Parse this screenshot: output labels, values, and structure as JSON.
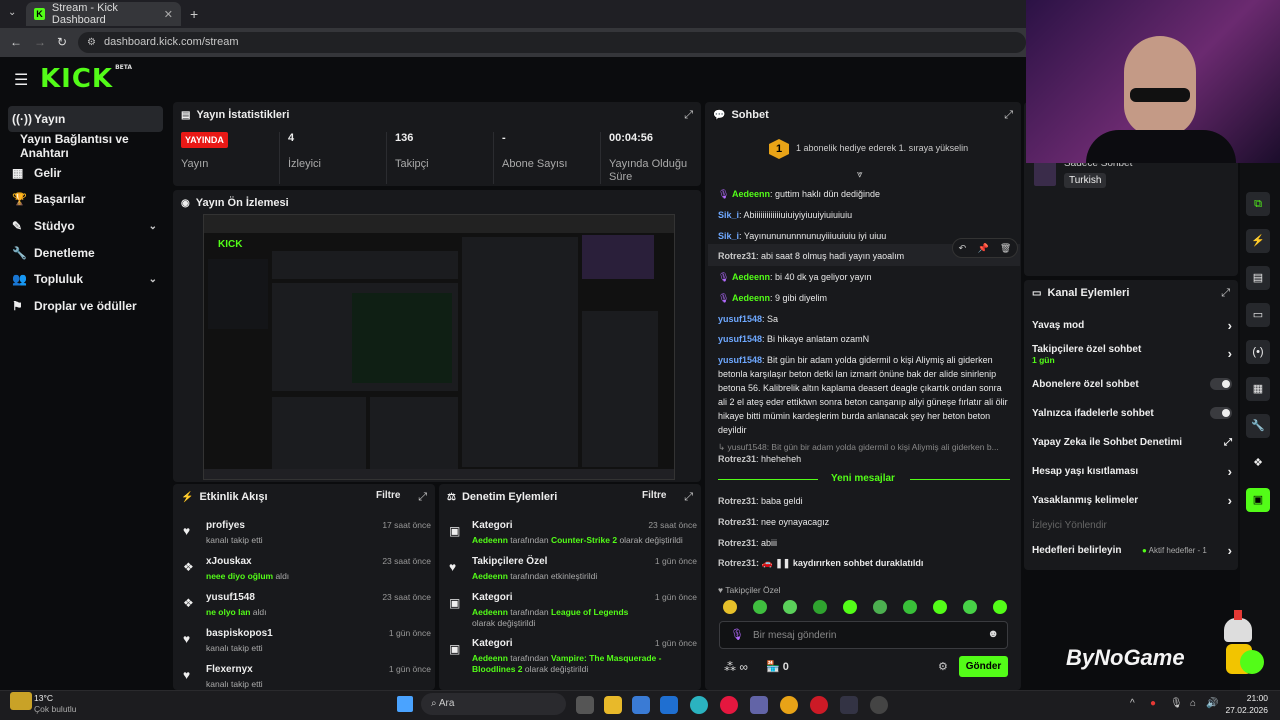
{
  "browser": {
    "tab_title": "Stream - Kick Dashboard",
    "url": "dashboard.kick.com/stream"
  },
  "logo": "KICK",
  "logo_badge": "BETA",
  "sidebar": {
    "items": [
      {
        "label": "Yayın",
        "icon": "stream-icon"
      },
      {
        "label": "Yayın Bağlantısı ve Anahtarı",
        "icon": ""
      },
      {
        "label": "Gelir",
        "icon": "revenue-icon"
      },
      {
        "label": "Başarılar",
        "icon": "trophy-icon"
      },
      {
        "label": "Stüdyo",
        "icon": "palette-icon"
      },
      {
        "label": "Denetleme",
        "icon": "wrench-icon"
      },
      {
        "label": "Topluluk",
        "icon": "users-icon"
      },
      {
        "label": "Droplar ve ödüller",
        "icon": "gift-icon"
      }
    ]
  },
  "stats": {
    "title": "Yayın İstatistikleri",
    "status_badge": "YAYINDA",
    "status_label": "Yayın",
    "viewers_value": "4",
    "viewers_label": "İzleyici",
    "followers_value": "136",
    "followers_label": "Takipçi",
    "subs_value": "-",
    "subs_label": "Abone Sayısı",
    "uptime_value": "00:04:56",
    "uptime_label": "Yayında Olduğu Süre"
  },
  "preview": {
    "title": "Yayın Ön İzlemesi"
  },
  "activity": {
    "title": "Etkinlik Akışı",
    "filter": "Filtre",
    "rows": [
      {
        "name": "profiyes",
        "desc": "kanalı takip etti",
        "time": "17 saat önce",
        "highlight": ""
      },
      {
        "name": "xJouskax",
        "desc": "aldı",
        "time": "23 saat önce",
        "highlight": "neee diyo oğlum"
      },
      {
        "name": "yusuf1548",
        "desc": "aldı",
        "time": "23 saat önce",
        "highlight": "ne olyo lan"
      },
      {
        "name": "baspiskopos1",
        "desc": "kanalı takip etti",
        "time": "1 gün önce",
        "highlight": ""
      },
      {
        "name": "Flexernyx",
        "desc": "kanalı takip etti",
        "time": "1 gün önce",
        "highlight": ""
      }
    ]
  },
  "moderation": {
    "title": "Denetim Eylemleri",
    "filter": "Filtre",
    "rows": [
      {
        "name": "Kategori",
        "user": "Aedeenn",
        "mid": "tarafından",
        "val": "Counter-Strike 2",
        "end": "olarak değiştirildi",
        "time": "23 saat önce"
      },
      {
        "name": "Takipçilere Özel",
        "user": "Aedeenn",
        "mid": "tarafından etkinleştirildi",
        "val": "",
        "end": "",
        "time": "1 gün önce"
      },
      {
        "name": "Kategori",
        "user": "Aedeenn",
        "mid": "tarafından",
        "val": "League of Legends",
        "end": "olarak değiştirildi",
        "time": "1 gün önce"
      },
      {
        "name": "Kategori",
        "user": "Aedeenn",
        "mid": "tarafından",
        "val": "Vampire: The Masquerade - Bloodlines 2",
        "end": "olarak değiştirildi",
        "time": "1 gün önce"
      }
    ]
  },
  "chat": {
    "title": "Sohbet",
    "gift_text": "1 abonelik hediye ederek 1. sıraya yükselin",
    "gift_rank": "1",
    "messages": [
      {
        "user": "Aedeenn",
        "text": "guttim haklı dün dediğinde",
        "color": "#53fc18",
        "badge": true
      },
      {
        "user": "Sik_i",
        "text": "Abiiiiiiiiiiiiiuiuiyiyiuuiyiuiuiuiu",
        "color": "#6ea8ff",
        "badge": false
      },
      {
        "user": "Sik_i",
        "text": "Yayınunununnnunuyiiiuuiuiu iyi uiuu",
        "color": "#6ea8ff",
        "badge": false
      },
      {
        "user": "Rotrez31",
        "text": "abi saat 8 olmuş hadi yayın yaoalım",
        "color": "#c8c8c8",
        "badge": false
      },
      {
        "user": "Aedeenn",
        "text": "bi 40 dk ya geliyor yayın",
        "color": "#53fc18",
        "badge": true
      },
      {
        "user": "Aedeenn",
        "text": "9 gibi diyelim",
        "color": "#53fc18",
        "badge": true
      },
      {
        "user": "yusuf1548",
        "text": "Sa",
        "color": "#6ea8ff",
        "badge": false
      },
      {
        "user": "yusuf1548",
        "text": "Bi hikaye anlatam ozamN",
        "color": "#6ea8ff",
        "badge": false
      }
    ],
    "long_user": "yusuf1548",
    "long_text": "Bit gün bir adam yolda gidermil o kişi Aliymiş ali giderken betonla karşılaşır beton detki lan izmarit önüne bak der alide sinirlenip betona 56. Kalibrelik altın kaplama deasert deagle çıkartık ondan sonra ali 2 el ateş eder ettiktwn sonra beton canşanıp aliyi güneşe fırlatır ali ölir hikaye bitti mümin kardeşlerim burda anlanacak şey her beton beton deyildir",
    "reply_preview": "yusuf1548: Bit gün bir adam yolda gidermil o kişi Aliymiş ali giderken b...",
    "reply_user": "Rotrez31",
    "reply_text": "hheheheh",
    "new_messages": "Yeni mesajlar",
    "new": [
      {
        "user": "Rotrez31",
        "text": "baba geldi"
      },
      {
        "user": "Rotrez31",
        "text": "nee oynayacagız"
      },
      {
        "user": "Rotrez31",
        "text": "abiii"
      }
    ],
    "paused": "kaydırırken sohbet duraklatıldı",
    "followers_only": "Takipçiler Özel",
    "input_placeholder": "Bir mesaj gönderin",
    "infinity": "∞",
    "counter": "0",
    "send": "Gönder"
  },
  "channel_actions": {
    "title": "Kanal Eylemleri",
    "tag_title": "Sadece Sohbet",
    "tag_lang": "Turkish",
    "items": [
      {
        "label": "Yavaş mod",
        "sub": "",
        "control": "chevron"
      },
      {
        "label": "Takipçilere özel sohbet",
        "sub": "1 gün",
        "control": "chevron"
      },
      {
        "label": "Abonelere özel sohbet",
        "sub": "",
        "control": "toggle"
      },
      {
        "label": "Yalnızca ifadelerle sohbet",
        "sub": "",
        "control": "toggle"
      },
      {
        "label": "Yapay Zeka ile Sohbet Denetimi",
        "sub": "",
        "control": "external"
      },
      {
        "label": "Hesap yaşı kısıtlaması",
        "sub": "",
        "control": "chevron"
      },
      {
        "label": "Yasaklanmış kelimeler",
        "sub": "",
        "control": "chevron"
      },
      {
        "label": "İzleyici Yönlendir",
        "sub": "",
        "control": "disabled"
      },
      {
        "label": "Hedefleri belirleyin",
        "sub": "",
        "control": "chevron"
      }
    ],
    "goals_status": "Aktif hedefler - 1"
  },
  "watermark": "ByNoGame",
  "taskbar": {
    "weather_temp": "13°C",
    "weather_desc": "Çok bulutlu",
    "search_label": "Ara",
    "time": "21:00",
    "date": "27.02.2026"
  }
}
